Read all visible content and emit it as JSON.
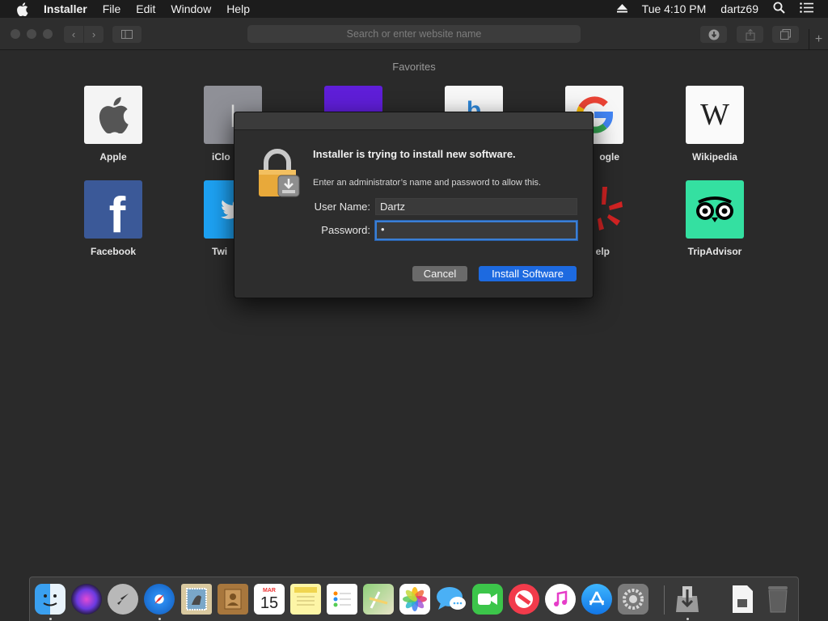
{
  "menubar": {
    "app_name": "Installer",
    "items": [
      "File",
      "Edit",
      "Window",
      "Help"
    ],
    "clock": "Tue 4:10 PM",
    "user": "dartz69"
  },
  "toolbar": {
    "address_placeholder": "Search or enter website name"
  },
  "favorites": {
    "title": "Favorites",
    "tiles": [
      {
        "label": "Apple"
      },
      {
        "label": "iClo"
      },
      {
        "label": ""
      },
      {
        "label": ""
      },
      {
        "label": "ogle"
      },
      {
        "label": "Wikipedia"
      },
      {
        "label": "Facebook"
      },
      {
        "label": "Twi"
      },
      {
        "label": "elp"
      },
      {
        "label": "TripAdvisor"
      }
    ]
  },
  "dialog": {
    "heading": "Installer is trying to install new software.",
    "subtext": "Enter an administrator’s name and password to allow this.",
    "username_label": "User Name:",
    "username_value": "Dartz",
    "password_label": "Password:",
    "password_value": "•",
    "cancel_label": "Cancel",
    "install_label": "Install Software"
  },
  "dock": {
    "calendar_month": "MAR",
    "calendar_day": "15"
  },
  "colors": {
    "accent": "#1d6ae0",
    "background": "#2a2a2a",
    "tripadvisor": "#34e0a1",
    "facebook": "#3b5998"
  }
}
